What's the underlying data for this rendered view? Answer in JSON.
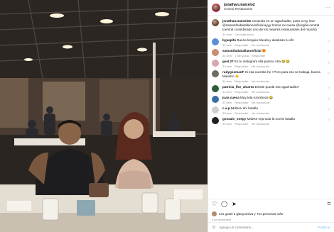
{
  "post": {
    "username": "jonathan.maicelo2",
    "location": "Central Restaurante",
    "more": "···"
  },
  "caption": {
    "username": "jonathan.maicelo2",
    "text": "Cenando en un agachadito, junto a my love @samanthabatallanosoficial ayyy broma mi causa @virgilio.central (central considerado uno de los mejores restaurantes del mundo)",
    "time": "34 sem",
    "action": "Ver traducción"
  },
  "comments": [
    {
      "user": "bypapito",
      "text": "Buena lenguia bloeda y alaskaso tu efri",
      "time": "33 sem",
      "action": "Responder",
      "translate": "Ver traducción"
    },
    {
      "user": "samanthabatallanosficial",
      "text": "😍",
      "time": "34 sem",
      "action": "1 Me gusta",
      "translate": "Responder"
    },
    {
      "user": "gsel.27",
      "text": "En tu instagram ella parece otra 😂😂",
      "time": "33 sem",
      "action": "Responder",
      "translate": "Ver traducción"
    },
    {
      "user": "rudygosmanF",
      "text": "Si esa cuentita he ! Pero para eso se trabaja, buena Maestro 👏",
      "time": "33 sem",
      "action": "Responder",
      "translate": "Ver traducción"
    },
    {
      "user": "patricia_flor_alvarez",
      "text": "Dónde queda ese agachadito?",
      "time": "33 sem",
      "action": "Responder",
      "translate": "Ver traducción"
    },
    {
      "user": "juan.cuesa",
      "text": "Muy tela eza kbeza 😂",
      "time": "33 sem",
      "action": "Responder",
      "translate": "Ver traducción"
    },
    {
      "user": "c.a.p.14",
      "text": "Bien ahí batalla",
      "time": "33 sem",
      "action": "Responder",
      "translate": "Ver traducción"
    },
    {
      "user": "gonzalo_snepy",
      "text": "Malese reja toda la noche batalla",
      "time": "33 sem",
      "action": "Responder",
      "translate": "Ver traducción"
    }
  ],
  "actions": {
    "like": "♡",
    "comment": "◯",
    "share": "➤",
    "save": "⌑"
  },
  "likes": "Les gustó a gianyoosiva y 721 personas más",
  "date": "4 de septiembre",
  "add_comment": {
    "placeholder": "Agrega un comentario...",
    "post": "Publicar"
  },
  "icons": {
    "options": "more-horizontal-icon",
    "like": "heart-icon",
    "comment": "comment-bubble-icon",
    "share": "paper-plane-icon",
    "save": "bookmark-icon",
    "emoji": "smiley-icon"
  }
}
